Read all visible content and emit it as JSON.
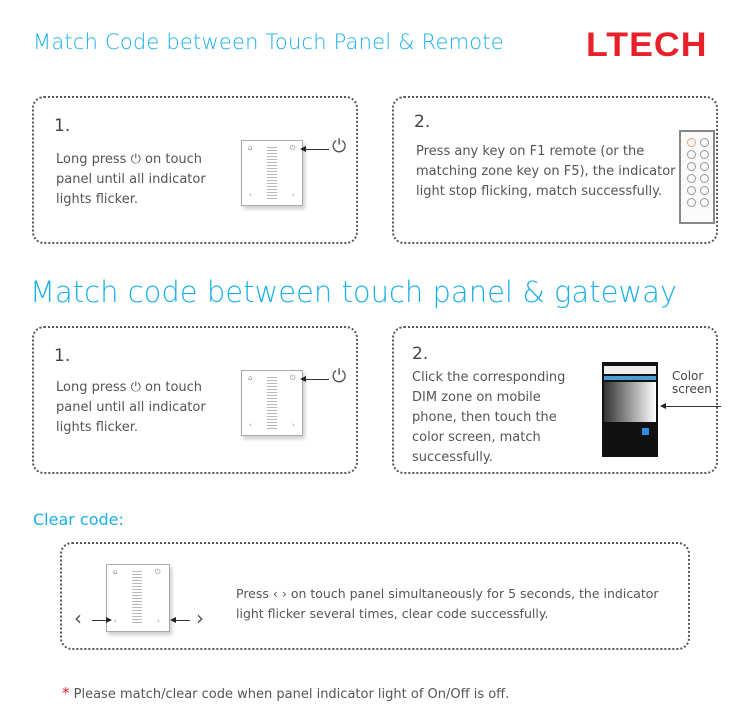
{
  "header": {
    "title": "Match Code between Touch Panel & Remote",
    "logo": "LTECH",
    "brand_color": "#e8202a",
    "accent_color": "#1ab0e8"
  },
  "remote_section": {
    "step1": {
      "number": "1.",
      "text_before_icon": "Long press",
      "icon": "power-icon",
      "text_after_icon_line1": "on touch",
      "line2": "panel until all indicator",
      "line3": "lights flicker."
    },
    "step2": {
      "number": "2.",
      "lines": [
        "Press any key on F1 remote (or the",
        "matching zone key on F5), the indicator",
        "light stop flicking, match successfully."
      ]
    }
  },
  "gateway_section": {
    "title": "Match code between touch panel & gateway",
    "step1": {
      "number": "1.",
      "text_before_icon": "Long press",
      "icon": "power-icon",
      "text_after_icon_line1": "on touch",
      "line2": "panel until all indicator",
      "line3": "lights flicker."
    },
    "step2": {
      "number": "2.",
      "lines": [
        "Click the corresponding",
        "DIM zone on mobile",
        "phone, then touch the",
        "color screen, match",
        "successfully."
      ],
      "callout_line1": "Color",
      "callout_line2": "screen"
    }
  },
  "clear_section": {
    "title": "Clear code:",
    "left_arrow": "‹",
    "right_arrow": "›",
    "line1": "Press ‹ › on touch panel simultaneously for 5 seconds, the indicator",
    "line2": "light flicker several times, clear code successfully."
  },
  "footer_note": {
    "star": "*",
    "text": "Please match/clear code when panel indicator light of On/Off is off."
  },
  "glyphs": {
    "power": "⏻",
    "lt": "‹",
    "gt": "›",
    "bulb": "⌂"
  }
}
